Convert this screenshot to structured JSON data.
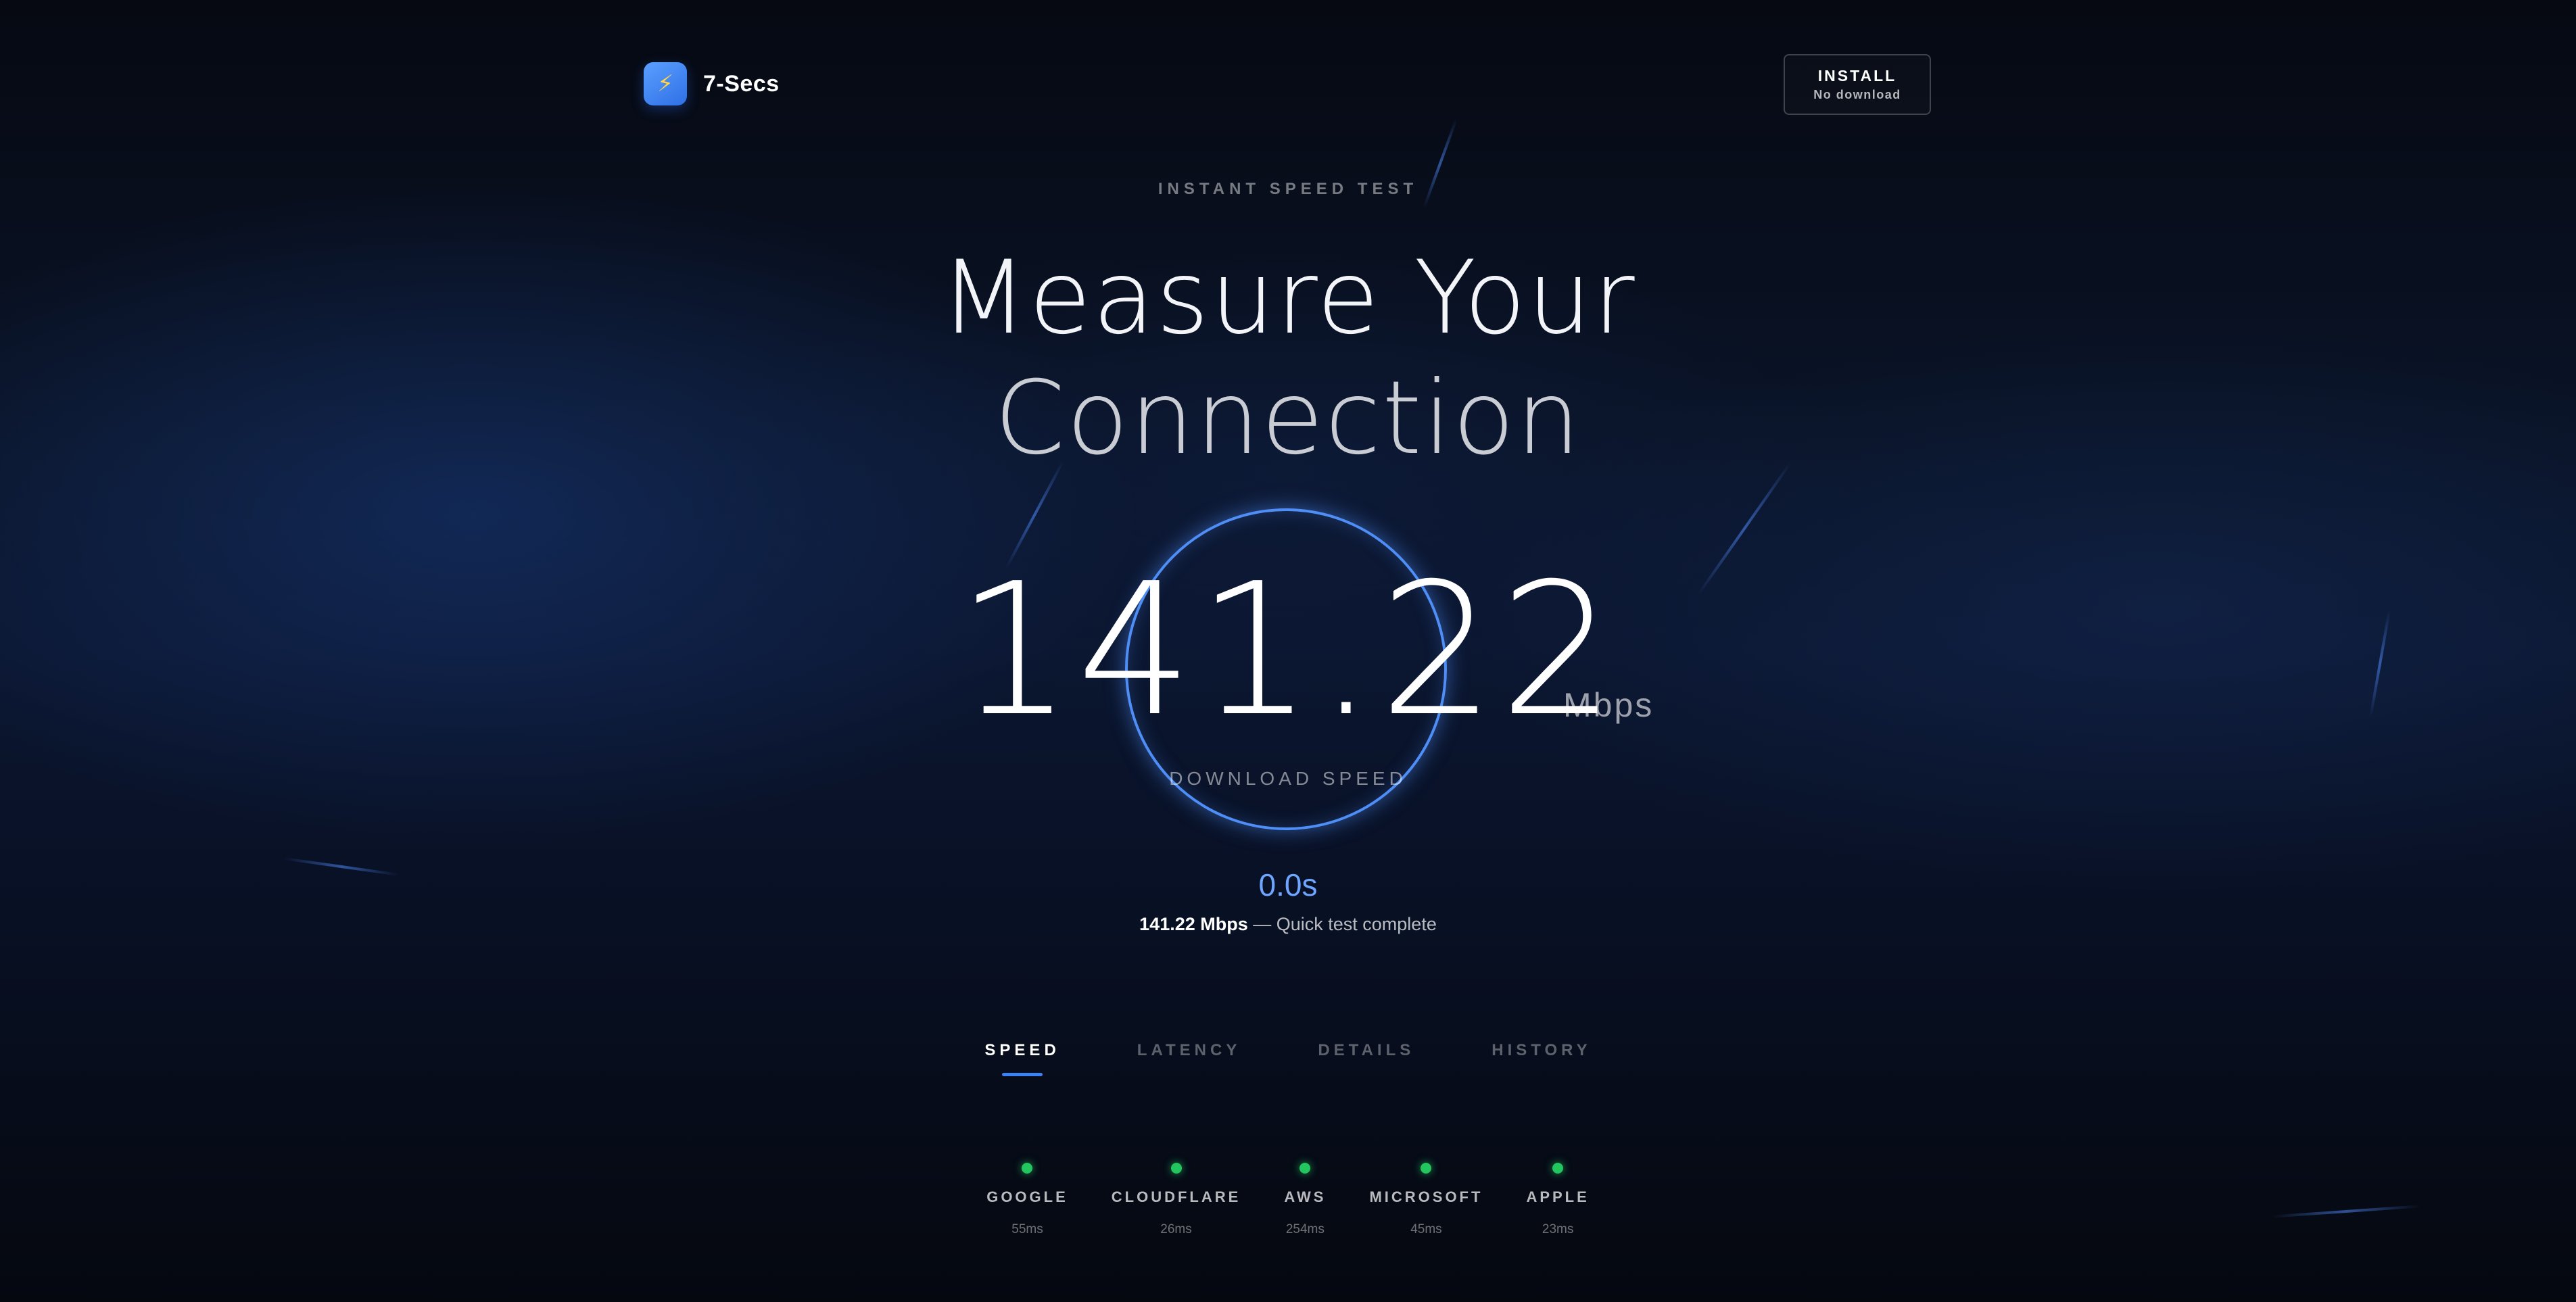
{
  "brand": {
    "name": "7-Secs",
    "logo_icon": "lightning-bolt-icon",
    "logo_glyph": "⚡"
  },
  "install": {
    "title": "INSTALL",
    "subtitle": "No download"
  },
  "hero": {
    "eyebrow": "INSTANT SPEED TEST",
    "headline_line1": "Measure Your",
    "headline_line2": "Connection"
  },
  "result": {
    "speed": "141.22",
    "unit": "Mbps",
    "label": "DOWNLOAD SPEED",
    "timer": "0.0s",
    "summary_strong": "141.22 Mbps",
    "summary_rest": " — Quick test complete"
  },
  "tabs": [
    {
      "label": "SPEED",
      "active": true
    },
    {
      "label": "LATENCY",
      "active": false
    },
    {
      "label": "DETAILS",
      "active": false
    },
    {
      "label": "HISTORY",
      "active": false
    }
  ],
  "servers": [
    {
      "name": "GOOGLE",
      "latency": "55ms",
      "status": "online"
    },
    {
      "name": "CLOUDFLARE",
      "latency": "26ms",
      "status": "online"
    },
    {
      "name": "AWS",
      "latency": "254ms",
      "status": "online"
    },
    {
      "name": "MICROSOFT",
      "latency": "45ms",
      "status": "online"
    },
    {
      "name": "APPLE",
      "latency": "23ms",
      "status": "online"
    }
  ],
  "colors": {
    "accent": "#3b82f6",
    "ring": "#4f8ef7",
    "timer": "#6ea6ff",
    "status_online": "#22c55e",
    "background": "#060a14"
  }
}
